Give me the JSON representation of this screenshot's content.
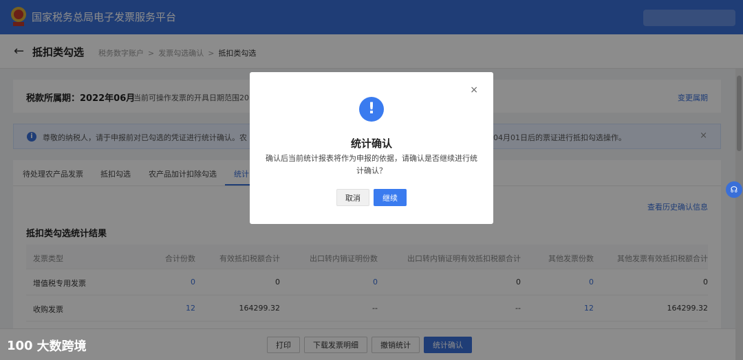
{
  "header": {
    "platform_title": "国家税务总局电子发票服务平台"
  },
  "breadcrumb": {
    "title": "抵扣类勾选",
    "items": [
      "税务数字账户",
      "发票勾选确认",
      "抵扣类勾选"
    ]
  },
  "period": {
    "label": "税款所属期：2022年06月",
    "hint": "当前可操作发票的开具日期范围20",
    "change_label": "变更属期"
  },
  "notice": {
    "text_left": "尊敬的纳税人，请于申报前对已勾选的凭证进行统计确认。农",
    "text_right": "04月01日后的票证进行抵扣勾选操作。"
  },
  "tabs": [
    "待处理农产品发票",
    "抵扣勾选",
    "农产品加计扣除勾选",
    "统计"
  ],
  "history_link": "查看历史确认信息",
  "section_title": "抵扣类勾选统计结果",
  "table": {
    "headers": [
      "发票类型",
      "合计份数",
      "有效抵扣税额合计",
      "出口转内销证明份数",
      "出口转内销证明有效抵扣税额合计",
      "其他发票份数",
      "其他发票有效抵扣税额合计"
    ],
    "rows": [
      [
        "增值税专用发票",
        "0",
        "0",
        "0",
        "0",
        "0",
        "0"
      ],
      [
        "收购发票",
        "12",
        "164299.32",
        "--",
        "--",
        "12",
        "164299.32"
      ]
    ]
  },
  "bottom_buttons": {
    "print": "打印",
    "download": "下载发票明细",
    "revoke": "撤销统计",
    "confirm": "统计确认"
  },
  "modal": {
    "icon": "!",
    "title": "统计确认",
    "body": "确认后当前统计报表将作为申报的依据，请确认是否继续进行统计确认？",
    "cancel": "取消",
    "ok": "继续"
  },
  "watermark": {
    "logo": "100",
    "text": "大数跨境"
  },
  "icons": {
    "back": "back-arrow-icon",
    "close": "close-icon",
    "info": "info-icon",
    "help": "headset-icon"
  },
  "colors": {
    "primary": "#3a6fd8",
    "modal_button": "#3a7bef"
  }
}
